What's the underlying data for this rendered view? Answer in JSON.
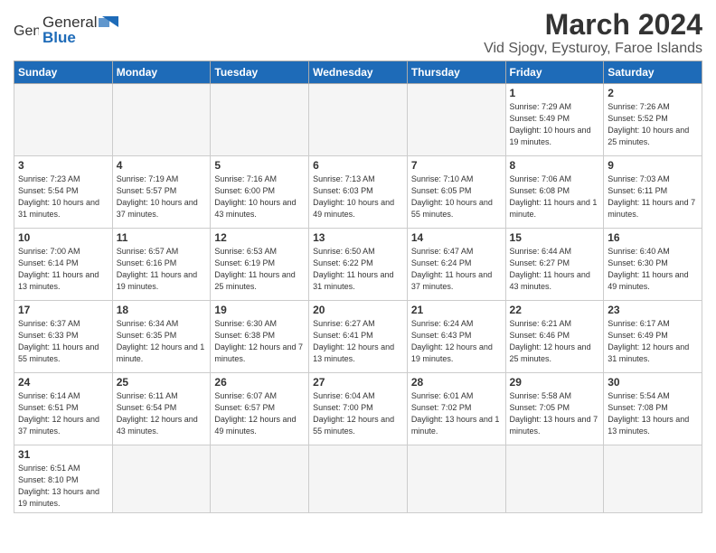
{
  "header": {
    "logo_general": "General",
    "logo_blue": "Blue",
    "month_year": "March 2024",
    "location": "Vid Sjogv, Eysturoy, Faroe Islands"
  },
  "weekdays": [
    "Sunday",
    "Monday",
    "Tuesday",
    "Wednesday",
    "Thursday",
    "Friday",
    "Saturday"
  ],
  "weeks": [
    [
      {
        "day": "",
        "info": ""
      },
      {
        "day": "",
        "info": ""
      },
      {
        "day": "",
        "info": ""
      },
      {
        "day": "",
        "info": ""
      },
      {
        "day": "",
        "info": ""
      },
      {
        "day": "1",
        "info": "Sunrise: 7:29 AM\nSunset: 5:49 PM\nDaylight: 10 hours and 19 minutes."
      },
      {
        "day": "2",
        "info": "Sunrise: 7:26 AM\nSunset: 5:52 PM\nDaylight: 10 hours and 25 minutes."
      }
    ],
    [
      {
        "day": "3",
        "info": "Sunrise: 7:23 AM\nSunset: 5:54 PM\nDaylight: 10 hours and 31 minutes."
      },
      {
        "day": "4",
        "info": "Sunrise: 7:19 AM\nSunset: 5:57 PM\nDaylight: 10 hours and 37 minutes."
      },
      {
        "day": "5",
        "info": "Sunrise: 7:16 AM\nSunset: 6:00 PM\nDaylight: 10 hours and 43 minutes."
      },
      {
        "day": "6",
        "info": "Sunrise: 7:13 AM\nSunset: 6:03 PM\nDaylight: 10 hours and 49 minutes."
      },
      {
        "day": "7",
        "info": "Sunrise: 7:10 AM\nSunset: 6:05 PM\nDaylight: 10 hours and 55 minutes."
      },
      {
        "day": "8",
        "info": "Sunrise: 7:06 AM\nSunset: 6:08 PM\nDaylight: 11 hours and 1 minute."
      },
      {
        "day": "9",
        "info": "Sunrise: 7:03 AM\nSunset: 6:11 PM\nDaylight: 11 hours and 7 minutes."
      }
    ],
    [
      {
        "day": "10",
        "info": "Sunrise: 7:00 AM\nSunset: 6:14 PM\nDaylight: 11 hours and 13 minutes."
      },
      {
        "day": "11",
        "info": "Sunrise: 6:57 AM\nSunset: 6:16 PM\nDaylight: 11 hours and 19 minutes."
      },
      {
        "day": "12",
        "info": "Sunrise: 6:53 AM\nSunset: 6:19 PM\nDaylight: 11 hours and 25 minutes."
      },
      {
        "day": "13",
        "info": "Sunrise: 6:50 AM\nSunset: 6:22 PM\nDaylight: 11 hours and 31 minutes."
      },
      {
        "day": "14",
        "info": "Sunrise: 6:47 AM\nSunset: 6:24 PM\nDaylight: 11 hours and 37 minutes."
      },
      {
        "day": "15",
        "info": "Sunrise: 6:44 AM\nSunset: 6:27 PM\nDaylight: 11 hours and 43 minutes."
      },
      {
        "day": "16",
        "info": "Sunrise: 6:40 AM\nSunset: 6:30 PM\nDaylight: 11 hours and 49 minutes."
      }
    ],
    [
      {
        "day": "17",
        "info": "Sunrise: 6:37 AM\nSunset: 6:33 PM\nDaylight: 11 hours and 55 minutes."
      },
      {
        "day": "18",
        "info": "Sunrise: 6:34 AM\nSunset: 6:35 PM\nDaylight: 12 hours and 1 minute."
      },
      {
        "day": "19",
        "info": "Sunrise: 6:30 AM\nSunset: 6:38 PM\nDaylight: 12 hours and 7 minutes."
      },
      {
        "day": "20",
        "info": "Sunrise: 6:27 AM\nSunset: 6:41 PM\nDaylight: 12 hours and 13 minutes."
      },
      {
        "day": "21",
        "info": "Sunrise: 6:24 AM\nSunset: 6:43 PM\nDaylight: 12 hours and 19 minutes."
      },
      {
        "day": "22",
        "info": "Sunrise: 6:21 AM\nSunset: 6:46 PM\nDaylight: 12 hours and 25 minutes."
      },
      {
        "day": "23",
        "info": "Sunrise: 6:17 AM\nSunset: 6:49 PM\nDaylight: 12 hours and 31 minutes."
      }
    ],
    [
      {
        "day": "24",
        "info": "Sunrise: 6:14 AM\nSunset: 6:51 PM\nDaylight: 12 hours and 37 minutes."
      },
      {
        "day": "25",
        "info": "Sunrise: 6:11 AM\nSunset: 6:54 PM\nDaylight: 12 hours and 43 minutes."
      },
      {
        "day": "26",
        "info": "Sunrise: 6:07 AM\nSunset: 6:57 PM\nDaylight: 12 hours and 49 minutes."
      },
      {
        "day": "27",
        "info": "Sunrise: 6:04 AM\nSunset: 7:00 PM\nDaylight: 12 hours and 55 minutes."
      },
      {
        "day": "28",
        "info": "Sunrise: 6:01 AM\nSunset: 7:02 PM\nDaylight: 13 hours and 1 minute."
      },
      {
        "day": "29",
        "info": "Sunrise: 5:58 AM\nSunset: 7:05 PM\nDaylight: 13 hours and 7 minutes."
      },
      {
        "day": "30",
        "info": "Sunrise: 5:54 AM\nSunset: 7:08 PM\nDaylight: 13 hours and 13 minutes."
      }
    ],
    [
      {
        "day": "31",
        "info": "Sunrise: 6:51 AM\nSunset: 8:10 PM\nDaylight: 13 hours and 19 minutes."
      },
      {
        "day": "",
        "info": ""
      },
      {
        "day": "",
        "info": ""
      },
      {
        "day": "",
        "info": ""
      },
      {
        "day": "",
        "info": ""
      },
      {
        "day": "",
        "info": ""
      },
      {
        "day": "",
        "info": ""
      }
    ]
  ]
}
